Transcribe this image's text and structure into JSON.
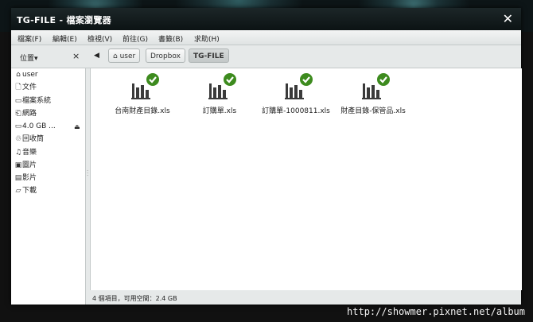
{
  "window": {
    "title": "TG-FILE - 檔案瀏覽器",
    "close_icon": "✕"
  },
  "menubar": {
    "items": [
      "檔案(F)",
      "編輯(E)",
      "檢視(V)",
      "前往(G)",
      "書籤(B)",
      "求助(H)"
    ]
  },
  "toolbar": {
    "places_label": "位置",
    "places_arrow": "▾",
    "places_close": "×",
    "back_icon": "◀",
    "breadcrumbs": [
      "user",
      "Dropbox",
      "TG-FILE"
    ],
    "home_icon": "⌂"
  },
  "sidebar": {
    "items": [
      {
        "icon": "⌂",
        "label": "user"
      },
      {
        "icon": "🗋",
        "label": "文件"
      },
      {
        "icon": "▭",
        "label": "檔案系統"
      },
      {
        "icon": "⎗",
        "label": "網路"
      },
      {
        "icon": "▭",
        "label": "4.0 GB ...",
        "eject": "⏏"
      },
      {
        "icon": "♲",
        "label": "回收筒"
      },
      {
        "icon": "♫",
        "label": "音樂"
      },
      {
        "icon": "▣",
        "label": "圖片"
      },
      {
        "icon": "▤",
        "label": "影片"
      },
      {
        "icon": "▱",
        "label": "下載"
      }
    ]
  },
  "files": [
    {
      "name": "台南財產目錄.xls",
      "icon": "spreadsheet-chart-icon",
      "badge": "checkmark-badge-icon"
    },
    {
      "name": "訂購單.xls",
      "icon": "spreadsheet-chart-icon",
      "badge": "checkmark-badge-icon"
    },
    {
      "name": "訂購單-1000811.xls",
      "icon": "spreadsheet-chart-icon",
      "badge": "checkmark-badge-icon"
    },
    {
      "name": "財產目錄-保管品.xls",
      "icon": "spreadsheet-chart-icon",
      "badge": "checkmark-badge-icon"
    }
  ],
  "status": {
    "text": "4 個項目，可用空間：2.4 GB"
  },
  "watermark": "http://showmer.pixnet.net/album",
  "colors": {
    "badge_green": "#3d8b1e",
    "icon_dark": "#3a3a3a"
  }
}
